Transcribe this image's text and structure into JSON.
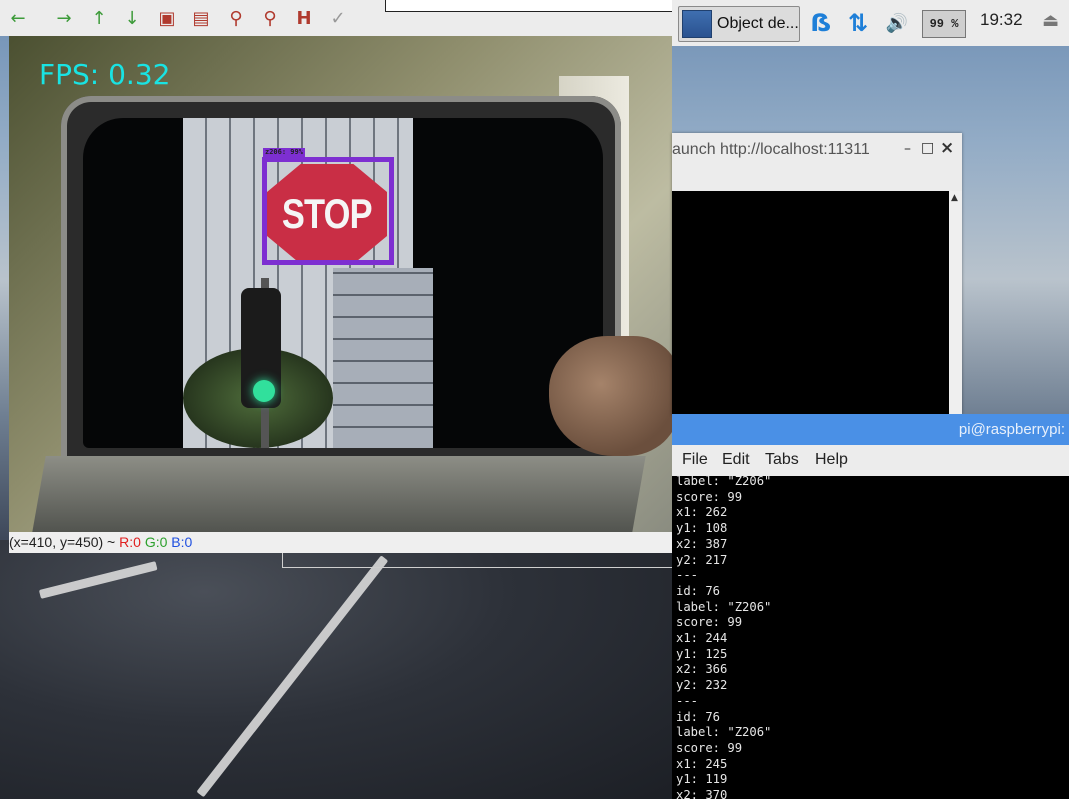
{
  "image_viewer": {
    "toolbar_icons": [
      "arrow-left-icon",
      "arrow-right-icon",
      "arrow-up-icon",
      "arrow-down-icon",
      "save-image-icon",
      "copy-image-icon",
      "zoom-in-icon",
      "zoom-out-icon",
      "zoom-fit-icon",
      "brush-icon"
    ],
    "fps_text": "FPS: 0.32",
    "stop_sign_text": "STOP",
    "detection_label": "z206: 99%",
    "status": {
      "coords": "(x=410, y=450) ~ ",
      "r": "R:0",
      "g": "G:0",
      "b": "B:0"
    }
  },
  "taskbar": {
    "task_label": "Object de...",
    "bluetooth_icon": "bluetooth-icon",
    "network_icon": "network-updown-icon",
    "volume_icon": "volume-icon",
    "cpu_usage": "99 %",
    "clock": "19:32",
    "eject_icon": "eject-icon"
  },
  "roslaunch_window": {
    "title": "aunch http://localhost:11311",
    "minimize": "–",
    "maximize": "□",
    "close": "×"
  },
  "terminal": {
    "title": "pi@raspberrypi:",
    "menu": [
      "File",
      "Edit",
      "Tabs",
      "Help"
    ],
    "lines": [
      "label: \"Z206\"",
      "score: 99",
      "x1: 262",
      "y1: 108",
      "x2: 387",
      "y2: 217",
      "---",
      "id: 76",
      "label: \"Z206\"",
      "score: 99",
      "x1: 244",
      "y1: 125",
      "x2: 366",
      "y2: 232",
      "---",
      "id: 76",
      "label: \"Z206\"",
      "score: 99",
      "x1: 245",
      "y1: 119",
      "x2: 370"
    ]
  },
  "colors": {
    "detection_box": "#7d2fd1",
    "fps_text": "#19e3e3",
    "terminal_title": "#4a90e6",
    "tray_blue": "#1e7fd8"
  }
}
